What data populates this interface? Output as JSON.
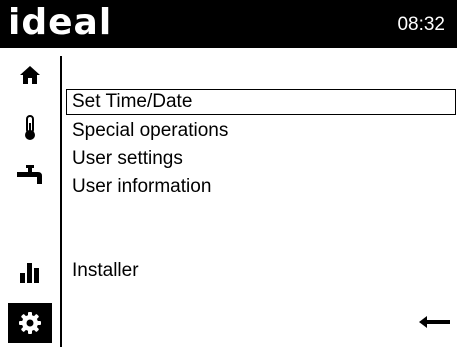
{
  "header": {
    "logo": "ideal",
    "time": "08:32"
  },
  "sidebar": {
    "items": [
      {
        "icon": "home-icon",
        "active": false
      },
      {
        "icon": "thermometer-icon",
        "active": false
      },
      {
        "icon": "tap-icon",
        "active": false
      },
      {
        "icon": "bar-chart-icon",
        "active": false
      },
      {
        "icon": "gear-icon",
        "active": true
      }
    ]
  },
  "menu": {
    "items": [
      {
        "label": "Set Time/Date",
        "selected": true
      },
      {
        "label": "Special operations",
        "selected": false
      },
      {
        "label": "User settings",
        "selected": false
      },
      {
        "label": "User information",
        "selected": false
      },
      {
        "label": "Installer",
        "selected": false
      }
    ]
  },
  "footer": {
    "back_icon": "back-arrow-icon"
  },
  "colors": {
    "foreground": "#000000",
    "background": "#ffffff"
  }
}
